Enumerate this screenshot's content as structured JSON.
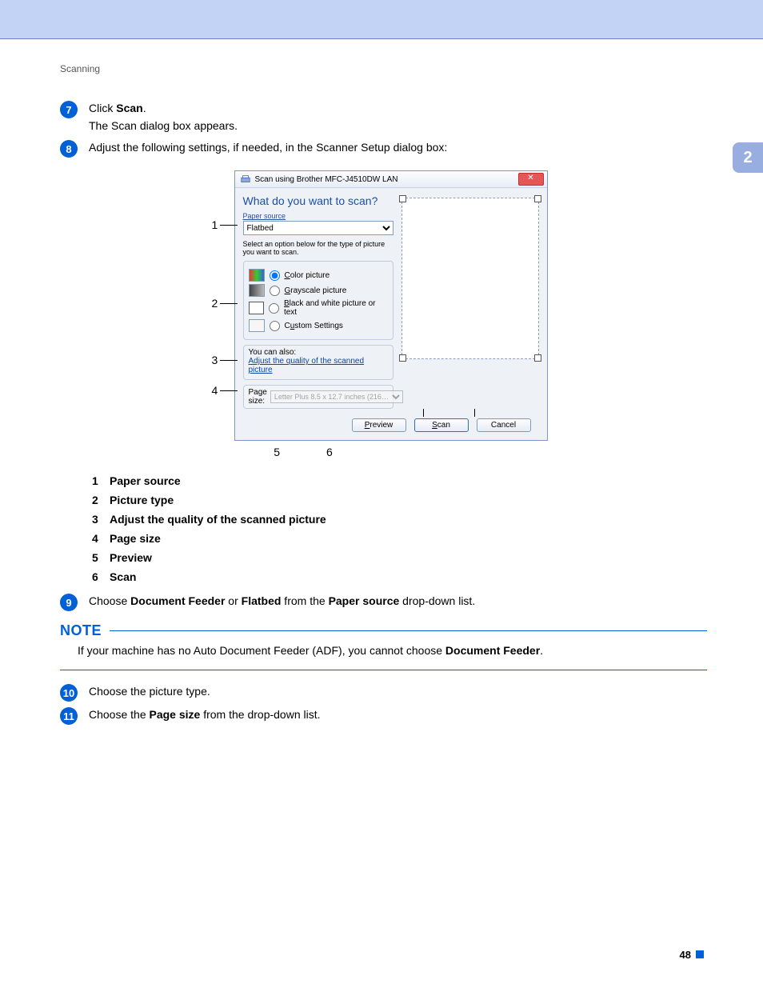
{
  "header": "Scanning",
  "chapter_tab": "2",
  "page_number": "48",
  "steps": {
    "s7": {
      "num": "7",
      "t1": "Click ",
      "b1": "Scan",
      "t2": ".",
      "line2": "The Scan dialog box appears."
    },
    "s8": {
      "num": "8",
      "text": "Adjust the following settings, if needed, in the Scanner Setup dialog box:"
    },
    "s9": {
      "num": "9",
      "t1": "Choose ",
      "b1": "Document Feeder",
      "t2": " or ",
      "b2": "Flatbed",
      "t3": " from the ",
      "b3": "Paper source",
      "t4": " drop-down list."
    },
    "s10": {
      "num": "10",
      "text": "Choose the picture type."
    },
    "s11": {
      "num": "11",
      "t1": "Choose the ",
      "b1": "Page size",
      "t2": " from the drop-down list."
    }
  },
  "list": {
    "i1": "Paper source",
    "i2": "Picture type",
    "i3": "Adjust the quality of the scanned picture",
    "i4": "Page size",
    "i5": "Preview",
    "i6": "Scan"
  },
  "note": {
    "title": "NOTE",
    "t1": "If your machine has no Auto Document Feeder (ADF), you cannot choose ",
    "b1": "Document Feeder",
    "t2": "."
  },
  "dialog": {
    "title": "Scan using Brother MFC-J4510DW LAN",
    "close": "✕",
    "heading": "What do you want to scan?",
    "paper_source_label": "Paper source",
    "paper_source_value": "Flatbed",
    "select_prompt": "Select an option below for the type of picture you want to scan.",
    "opt_color": "Color picture",
    "opt_gray": "Grayscale picture",
    "opt_bw": "Black and white picture or text",
    "opt_custom": "Custom Settings",
    "also_label": "You can also:",
    "adjust_link": "Adjust the quality of the scanned picture",
    "page_size_label": "Page size:",
    "page_size_value": "Letter Plus 8.5 x 12.7 inches (216…",
    "btn_preview": "Preview",
    "btn_scan": "Scan",
    "btn_cancel": "Cancel"
  },
  "callouts": {
    "c1": "1",
    "c2": "2",
    "c3": "3",
    "c4": "4",
    "c5": "5",
    "c6": "6"
  }
}
